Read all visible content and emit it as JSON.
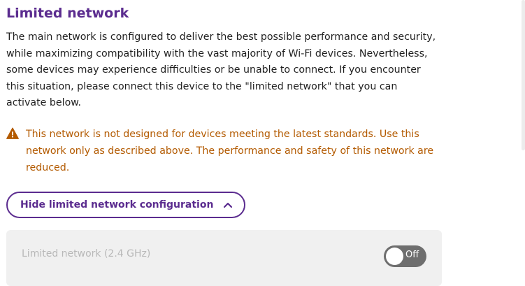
{
  "section": {
    "title": "Limited network",
    "description": "The main network is configured to deliver the best possible performance and security, while maximizing compatibility with the vast majority of Wi-Fi devices. Nevertheless, some devices may experience difficulties or be unable to connect. If you encounter this situation, please connect this device to the \"limited network\" that you can activate below."
  },
  "warning": {
    "icon": "warning-triangle-icon",
    "text": "This network is not designed for devices meeting the latest standards. Use this network only as described above. The performance and safety of this network are reduced.",
    "color": "#b35a00"
  },
  "config_toggle": {
    "label": "Hide limited network configuration",
    "icon": "chevron-up-icon"
  },
  "limited_network": {
    "label": "Limited network (2.4 GHz)",
    "switch_state": "Off",
    "enabled": false
  },
  "colors": {
    "accent": "#5b2c8f",
    "warning": "#b35a00",
    "panel_bg": "#f0f0f0",
    "switch_off": "#6e6e6e"
  }
}
